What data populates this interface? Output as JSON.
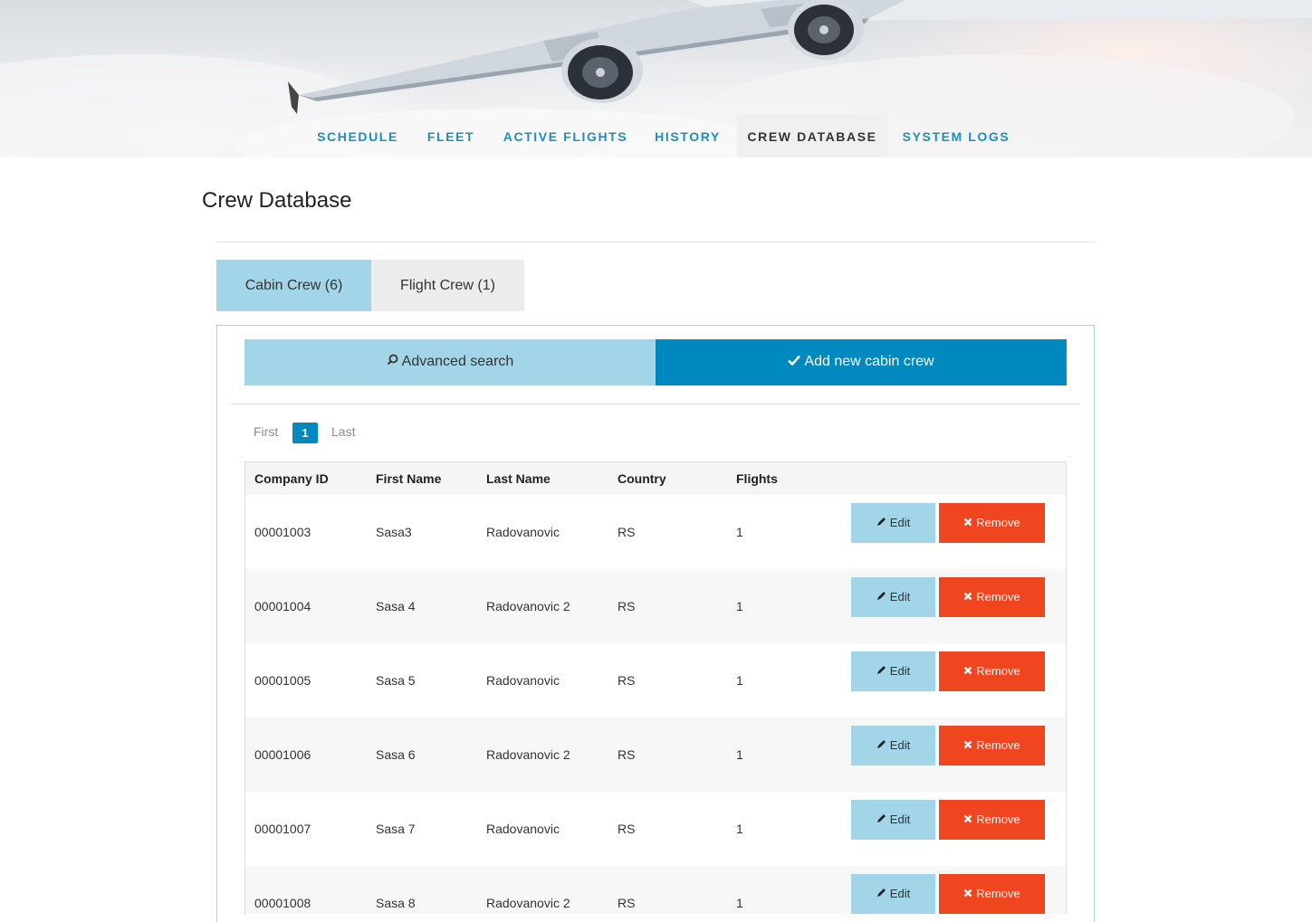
{
  "nav": {
    "items": [
      {
        "label": "SCHEDULE"
      },
      {
        "label": "FLEET"
      },
      {
        "label": "ACTIVE FLIGHTS"
      },
      {
        "label": "HISTORY"
      },
      {
        "label": "CREW DATABASE"
      },
      {
        "label": "SYSTEM LOGS"
      }
    ],
    "active": "CREW DATABASE"
  },
  "page": {
    "title": "Crew Database"
  },
  "tabs": {
    "cabin": "Cabin Crew (6)",
    "flight": "Flight Crew (1)",
    "active": "Cabin Crew (6)"
  },
  "actions": {
    "advanced_search": "Advanced search",
    "add_new": "Add new cabin crew",
    "search_icon": "magnifier-icon",
    "check_icon": "check-icon"
  },
  "pagination": {
    "first": "First",
    "current": "1",
    "last": "Last"
  },
  "table": {
    "headers": [
      "Company ID",
      "First Name",
      "Last Name",
      "Country",
      "Flights"
    ],
    "rows": [
      {
        "company_id": "00001003",
        "first_name": "Sasa3",
        "last_name": "Radovanovic",
        "country": "RS",
        "flights": "1"
      },
      {
        "company_id": "00001004",
        "first_name": "Sasa 4",
        "last_name": "Radovanovic 2",
        "country": "RS",
        "flights": "1"
      },
      {
        "company_id": "00001005",
        "first_name": "Sasa 5",
        "last_name": "Radovanovic",
        "country": "RS",
        "flights": "1"
      },
      {
        "company_id": "00001006",
        "first_name": "Sasa 6",
        "last_name": "Radovanovic 2",
        "country": "RS",
        "flights": "1"
      },
      {
        "company_id": "00001007",
        "first_name": "Sasa 7",
        "last_name": "Radovanovic",
        "country": "RS",
        "flights": "1"
      },
      {
        "company_id": "00001008",
        "first_name": "Sasa 8",
        "last_name": "Radovanovic 2",
        "country": "RS",
        "flights": "1"
      }
    ],
    "edit_label": "Edit",
    "remove_label": "Remove"
  },
  "colors": {
    "accent": "#0089bf",
    "light_accent": "#a3d5e9",
    "danger": "#f0461f",
    "nav_text": "#1b8fc2"
  }
}
